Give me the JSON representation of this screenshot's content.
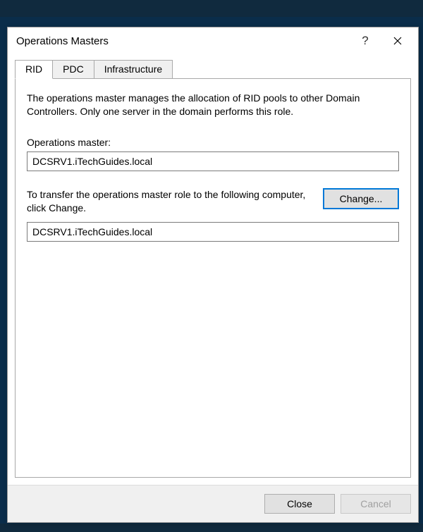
{
  "window": {
    "title": "Operations Masters",
    "help_tooltip": "?",
    "close_tooltip": "Close"
  },
  "tabs": {
    "rid": "RID",
    "pdc": "PDC",
    "infrastructure": "Infrastructure"
  },
  "panel": {
    "description": "The operations master manages the allocation of RID pools to other Domain Controllers. Only one server in the domain performs this role.",
    "label_current": "Operations master:",
    "value_current": "DCSRV1.iTechGuides.local",
    "transfer_text": "To transfer the operations master role to the following computer, click Change.",
    "change_label": "Change...",
    "value_target": "DCSRV1.iTechGuides.local"
  },
  "footer": {
    "close": "Close",
    "cancel": "Cancel"
  }
}
